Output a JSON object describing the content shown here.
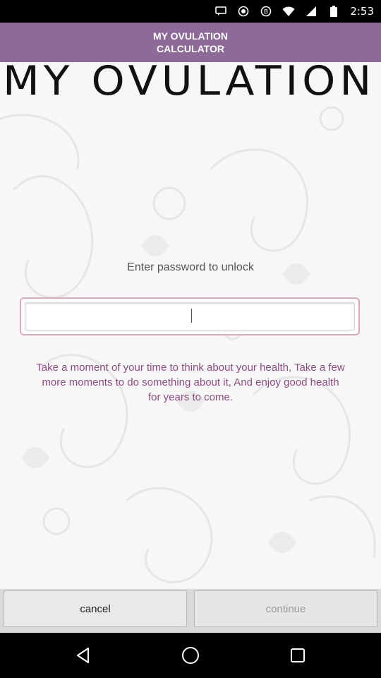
{
  "status_bar": {
    "time": "2:53",
    "icons": [
      "message-icon",
      "record-icon",
      "bitcoin-icon",
      "wifi-icon",
      "signal-icon",
      "battery-icon"
    ]
  },
  "header": {
    "title": "MY OVULATION CALCULATOR",
    "color": "#8e6a99"
  },
  "banner": {
    "text": "MY OVULATION"
  },
  "unlock": {
    "prompt": "Enter password to unlock",
    "password_value": "",
    "accent_color": "#e0a9c3"
  },
  "message": {
    "text": "Take a moment of your time to think about your health, Take a few more moments to do something about it, And enjoy good health for years to come.",
    "color": "#8e4c85"
  },
  "buttons": {
    "cancel_label": "cancel",
    "continue_label": "continue"
  },
  "nav": {
    "icons": [
      "back-icon",
      "home-icon",
      "recents-icon"
    ]
  }
}
